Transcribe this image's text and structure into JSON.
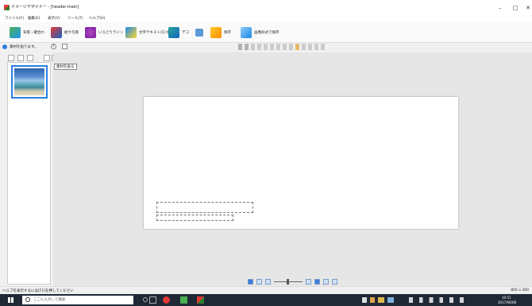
{
  "window": {
    "title": "イメージデザイナー - [header-main]",
    "minimize": "–",
    "maximize": "□",
    "close": "✕"
  },
  "menu": [
    "ファイル(F)",
    "編集(E)",
    "表示(V)",
    "ツール(T)",
    "ヘルプ(H)"
  ],
  "ribbon": {
    "background_label": "背景・鍵合わ",
    "photo_label": "絵や写真",
    "shape_label": "いろどりライン",
    "text_label": "文字テキスト/ロゴ",
    "deco_label": "デコ",
    "save_label": "保存",
    "export_label": "画像形式で保存"
  },
  "panel": {
    "header": "素材を貼ります。",
    "help": "?"
  },
  "tooltip": "素材を貼る",
  "status": {
    "help_text": "ヘルプを表示するには[F1]を押してください",
    "size": "800 x 300"
  },
  "taskbar": {
    "search_placeholder": "ここに入力して検索",
    "time": "19:51",
    "date": "2017/06/08"
  },
  "colors": {
    "selection": "#2a7de1",
    "taskbar": "#1f2936"
  }
}
